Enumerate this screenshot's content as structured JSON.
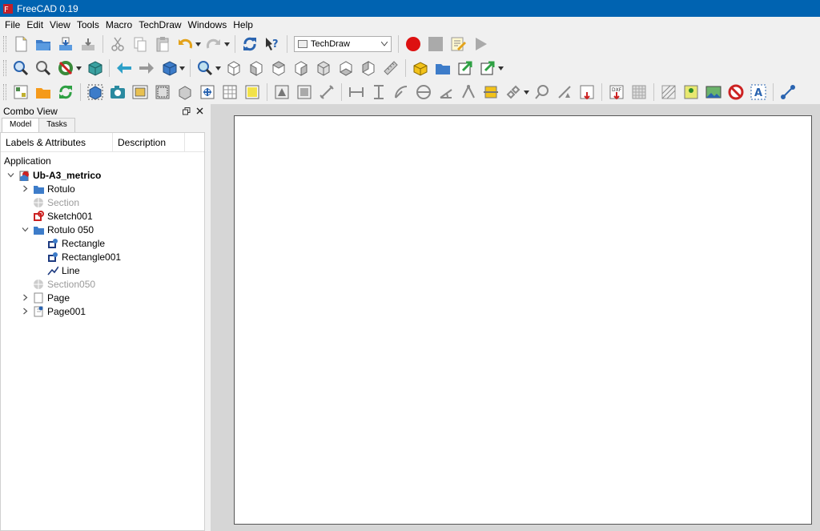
{
  "window": {
    "title": "FreeCAD 0.19"
  },
  "menu": [
    "File",
    "Edit",
    "View",
    "Tools",
    "Macro",
    "TechDraw",
    "Windows",
    "Help"
  ],
  "toolbar1": {
    "workbench_selected": "TechDraw",
    "icons": [
      "new-document-icon",
      "open-document-icon",
      "save-document-icon",
      "save-as-icon",
      "cut-icon",
      "copy-icon",
      "paste-icon",
      "undo-icon",
      "redo-icon",
      "refresh-icon",
      "whats-this-icon",
      "macro-record-icon",
      "macro-stop-icon",
      "macro-edit-icon",
      "macro-run-icon"
    ]
  },
  "toolbar2": {
    "icons": [
      "fit-all-icon",
      "fit-selection-icon",
      "draw-style-icon",
      "bounding-box-icon",
      "back-icon",
      "forward-icon",
      "standard-views-icon",
      "zoom-icon",
      "isometric-view-icon",
      "front-view-icon",
      "top-view-icon",
      "right-view-icon",
      "rear-view-icon",
      "bottom-view-icon",
      "left-view-icon",
      "measure-distance-icon",
      "create-part-icon",
      "create-group-icon",
      "link-icon",
      "link-actions-icon"
    ]
  },
  "toolbar3": {
    "icons": [
      "insert-page-icon",
      "insert-template-page-icon",
      "redraw-page-icon",
      "insert-view-icon",
      "active-view-icon",
      "section-view-icon",
      "detail-view-icon",
      "arch-view-icon",
      "draft-view-icon",
      "spreadsheet-view-icon",
      "annotation-icon",
      "symbol-icon",
      "image-icon",
      "length-dimension-icon",
      "horizontal-dimension-icon",
      "vertical-dimension-icon",
      "radius-dimension-icon",
      "diameter-dimension-icon",
      "angle-dimension-icon",
      "three-point-angle-icon",
      "extent-dimension-icon",
      "link-dimension-icon",
      "balloon-icon",
      "landmark-dimension-icon",
      "export-svg-icon",
      "export-dxf-icon",
      "hatch-icon",
      "geom-hatch-icon",
      "toggle-frames-icon",
      "image-insert-icon",
      "clear-icon",
      "rich-annotation-icon",
      "leader-line-icon"
    ]
  },
  "combo_view": {
    "title": "Combo View",
    "tabs": [
      "Model",
      "Tasks"
    ],
    "columns": [
      "Labels & Attributes",
      "Description"
    ],
    "section": "Application",
    "tree": [
      {
        "label": "Ub-A3_metrico",
        "depth": 0,
        "expander": "open",
        "icon": "document-icon",
        "bold": true
      },
      {
        "label": "Rotulo",
        "depth": 1,
        "expander": "closed",
        "icon": "folder-icon"
      },
      {
        "label": "Section",
        "depth": 1,
        "expander": "none",
        "icon": "section-icon",
        "dim": true
      },
      {
        "label": "Sketch001",
        "depth": 1,
        "expander": "none",
        "icon": "sketch-icon"
      },
      {
        "label": "Rotulo 050",
        "depth": 1,
        "expander": "open",
        "icon": "folder-icon"
      },
      {
        "label": "Rectangle",
        "depth": 2,
        "expander": "none",
        "icon": "draft-rectangle-icon"
      },
      {
        "label": "Rectangle001",
        "depth": 2,
        "expander": "none",
        "icon": "draft-rectangle-icon"
      },
      {
        "label": "Line",
        "depth": 2,
        "expander": "none",
        "icon": "draft-line-icon"
      },
      {
        "label": "Section050",
        "depth": 1,
        "expander": "none",
        "icon": "section-icon",
        "dim": true
      },
      {
        "label": "Page",
        "depth": 1,
        "expander": "closed",
        "icon": "page-icon"
      },
      {
        "label": "Page001",
        "depth": 1,
        "expander": "closed",
        "icon": "page-template-icon"
      }
    ]
  },
  "colors": {
    "titlebar": "#0063b1",
    "record": "#dd1111",
    "accent_blue": "#3d7cc9",
    "accent_green": "#2ea043"
  }
}
